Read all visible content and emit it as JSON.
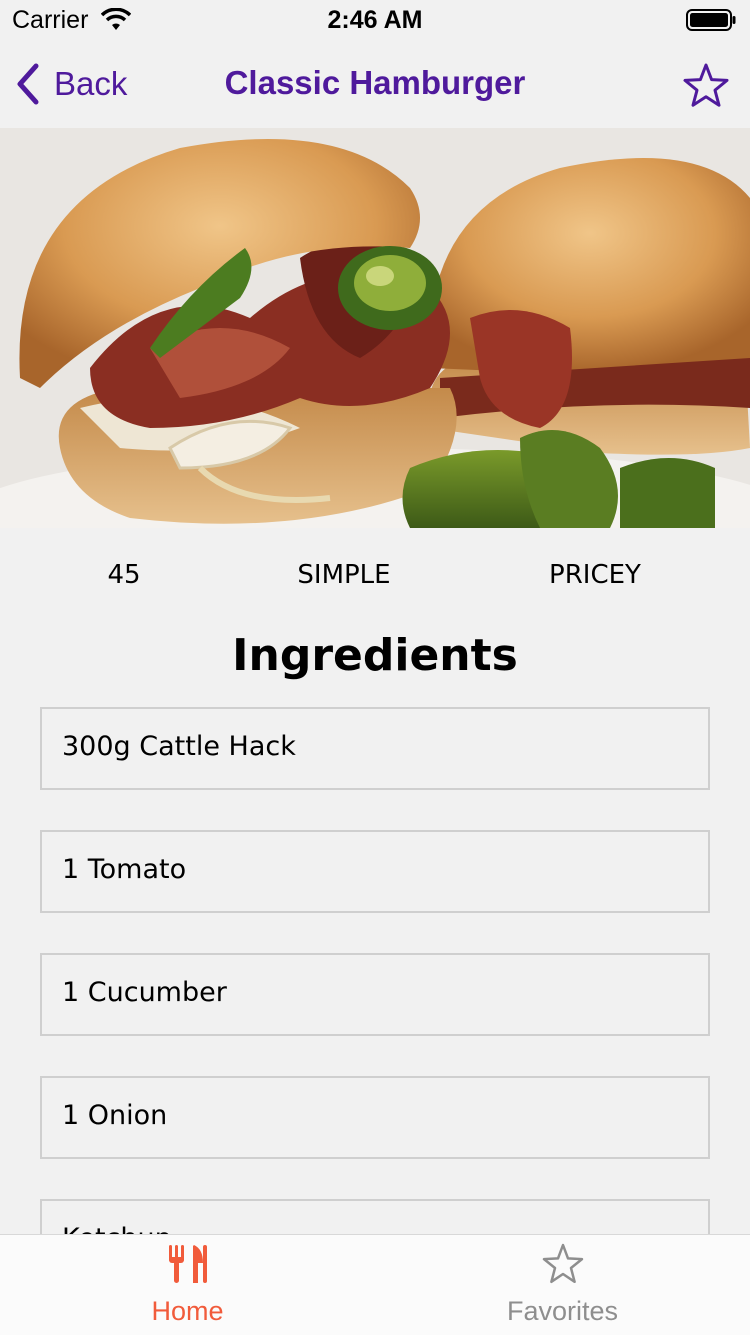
{
  "status_bar": {
    "carrier": "Carrier",
    "time": "2:46 AM"
  },
  "nav": {
    "back_label": "Back",
    "title": "Classic Hamburger"
  },
  "meta": {
    "duration": "45",
    "complexity": "SIMPLE",
    "affordability": "PRICEY"
  },
  "ingredients": {
    "title": "Ingredients",
    "items": [
      "300g Cattle Hack",
      "1 Tomato",
      "1 Cucumber",
      "1 Onion",
      "Ketchup"
    ]
  },
  "tabs": [
    {
      "label": "Home",
      "icon": "cutlery-icon",
      "active": true
    },
    {
      "label": "Favorites",
      "icon": "star-icon",
      "active": false
    }
  ],
  "colors": {
    "nav_accent": "#4f1a9c",
    "tab_active": "#f15b3b",
    "tab_inactive": "#8e8e8e"
  }
}
